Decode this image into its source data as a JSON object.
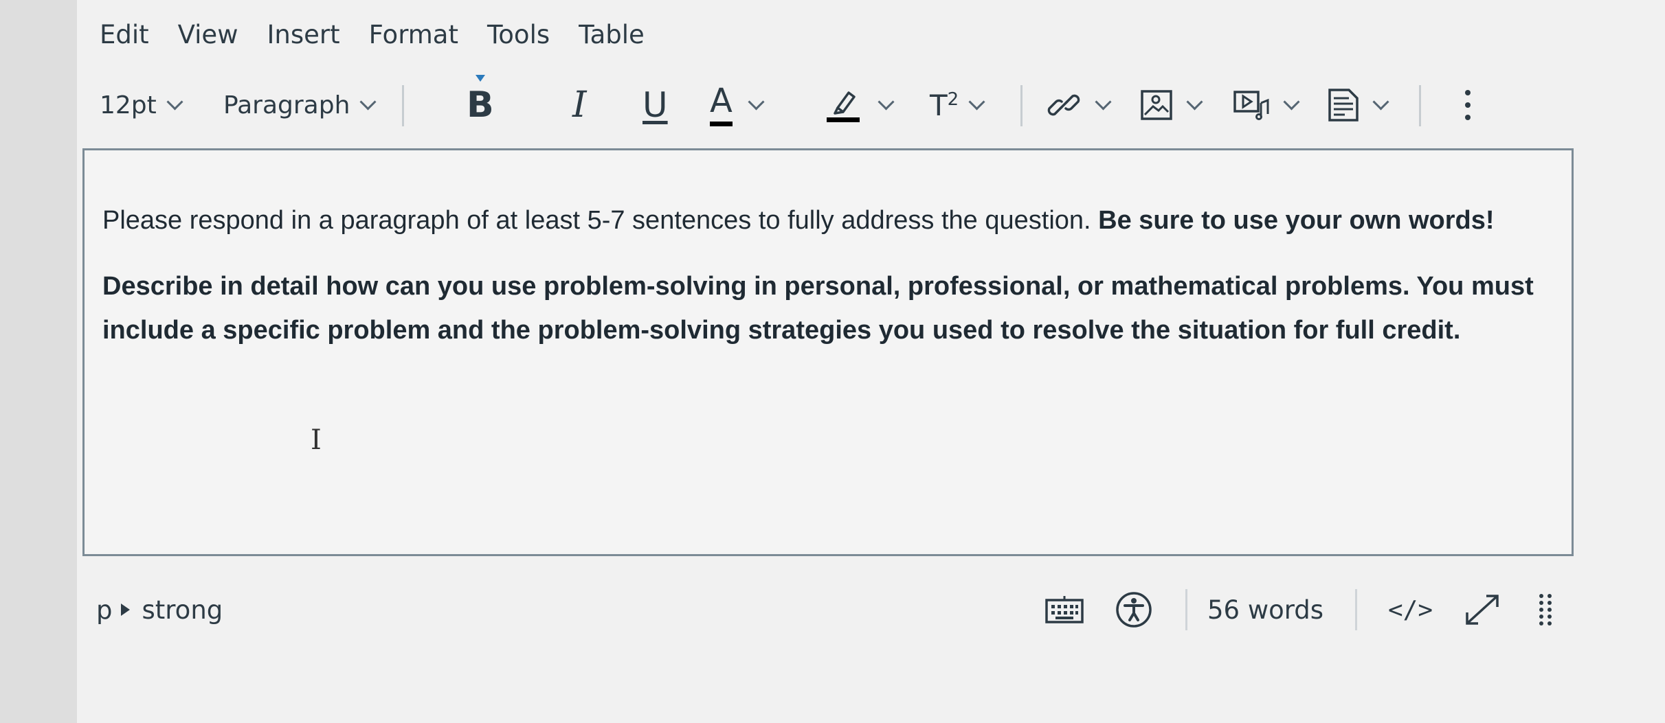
{
  "menu": [
    "Edit",
    "View",
    "Insert",
    "Format",
    "Tools",
    "Table"
  ],
  "toolbar": {
    "font_size": "12pt",
    "block_format": "Paragraph",
    "bold": "B",
    "italic": "I",
    "underline": "U",
    "font_color": "A",
    "superscript_base": "T",
    "superscript_exp": "2",
    "icons": [
      "chevron-down-icon",
      "highlighter-icon",
      "link-icon",
      "image-icon",
      "media-icon",
      "document-icon",
      "more-vertical-icon"
    ],
    "colors": {
      "text_color_bar": "#000000",
      "highlight_bar": "#000000",
      "bold_indicator": "#2b7abc"
    }
  },
  "content": {
    "para1_normal": "Please respond in a paragraph of at least 5-7 sentences to fully address the question. ",
    "para1_bold": "Be sure to use your own words!",
    "para2_bold": "Describe in detail how can you use problem-solving in personal, professional, or mathematical problems. You must include a specific problem and the problem-solving strategies you used to resolve the situation for full credit."
  },
  "statusbar": {
    "path_p": "p",
    "path_strong": "strong",
    "word_count": "56 words",
    "html_toggle": "</>"
  }
}
